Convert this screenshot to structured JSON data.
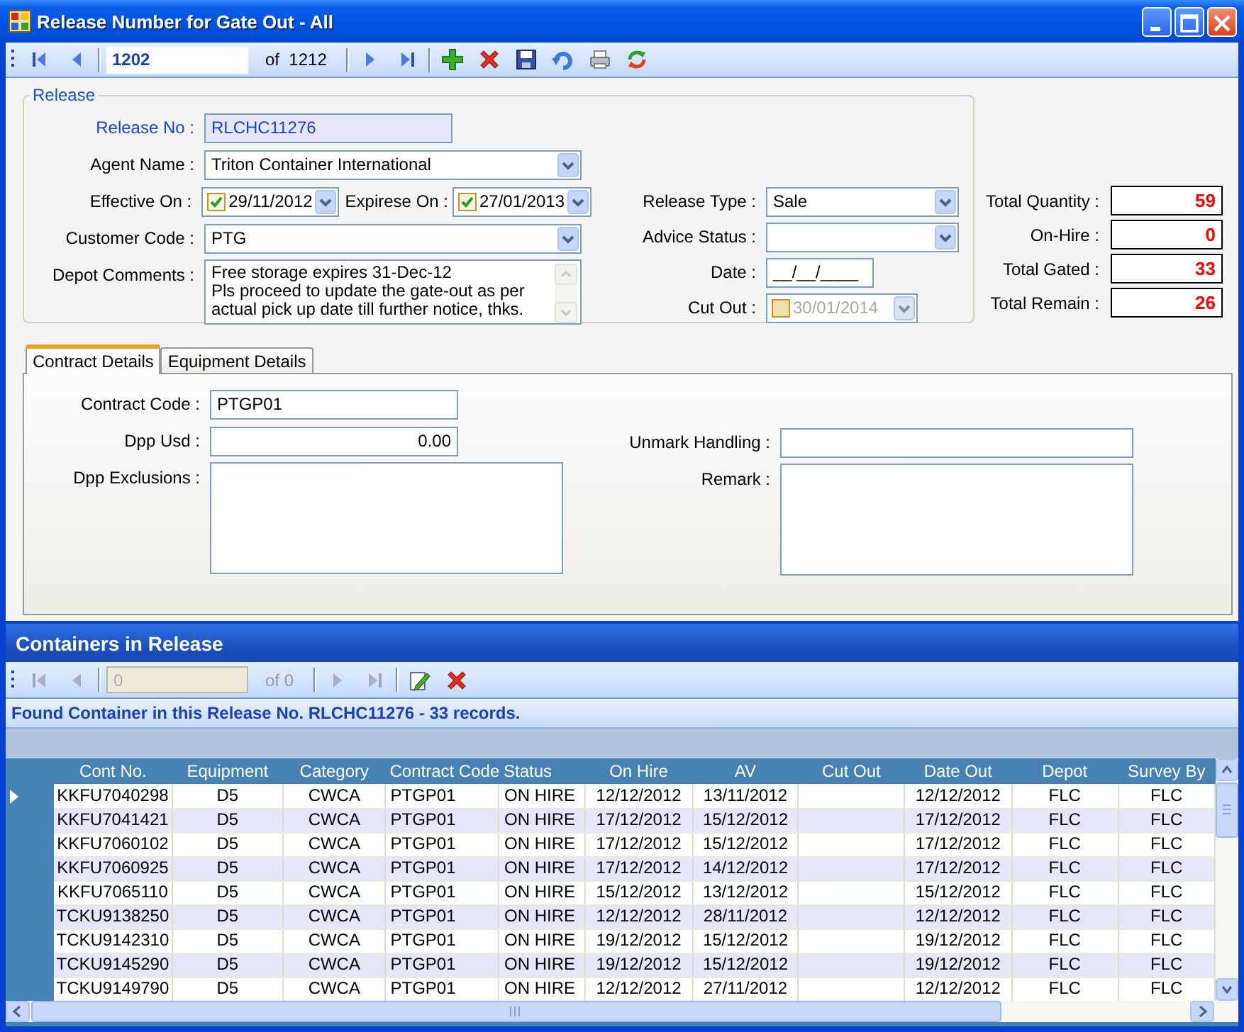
{
  "window": {
    "title": "Release Number for Gate Out - All"
  },
  "navigator": {
    "record": "1202",
    "total": "of  1212"
  },
  "release": {
    "legend": "Release",
    "left_fields": [
      {
        "kind": "readonly",
        "label": "Release No :",
        "value": "RLCHC11276"
      },
      {
        "kind": "combo",
        "label": "Agent Name :",
        "value": "Triton Container International"
      },
      {
        "kind": "date_pair",
        "label": "Effective On :",
        "dates": [
          {
            "value": "29/11/2012",
            "checked": true
          },
          {
            "label": "Expirese On :",
            "value": "27/01/2013",
            "checked": true
          }
        ]
      },
      {
        "kind": "combo",
        "label": "Customer Code :",
        "value": "PTG"
      },
      {
        "kind": "memo",
        "label": "Depot Comments :",
        "value": "Free storage expires 31-Dec-12\nPls proceed to update the gate-out as per actual pick up date till further notice, thks."
      }
    ],
    "right_fields": [
      {
        "kind": "combo",
        "label": "Release Type :",
        "value": "Sale"
      },
      {
        "kind": "combo",
        "label": "Advice Status :"
      },
      {
        "kind": "masked",
        "label": "Date :",
        "value": "__/__/____"
      },
      {
        "kind": "date",
        "label": "Cut Out :",
        "value": "30/01/2014",
        "checked": false,
        "disabled": true
      }
    ]
  },
  "totals": [
    {
      "label": "Total Quantity :",
      "value": "59"
    },
    {
      "label": "On-Hire :",
      "value": "0"
    },
    {
      "label": "Total Gated :",
      "value": "33"
    },
    {
      "label": "Total Remain :",
      "value": "26"
    }
  ],
  "tabs": [
    {
      "label": "Contract Details",
      "selected": true
    },
    {
      "label": "Equipment Details",
      "selected": false
    }
  ],
  "contract": {
    "left_fields": [
      {
        "kind": "text",
        "label": "Contract Code :",
        "value": "PTGP01"
      },
      {
        "kind": "number",
        "label": "Dpp Usd :",
        "value": "0.00"
      },
      {
        "kind": "memo",
        "label": "Dpp Exclusions :"
      }
    ],
    "right_fields": [
      {
        "kind": "text",
        "label": "Unmark Handling :"
      },
      {
        "kind": "memo",
        "label": "Remark :"
      }
    ]
  },
  "containers": {
    "title": "Containers in Release",
    "navigator": {
      "record": "0",
      "total": "of 0"
    },
    "message": "Found Container in this Release No. RLCHC11276 - 33 records.",
    "columns": [
      "Cont No.",
      "Equipment",
      "Category",
      "Contract Code",
      "Status",
      "On Hire",
      "AV",
      "Cut Out",
      "Date Out",
      "Depot",
      "Survey By"
    ],
    "rows": [
      {
        "current": true,
        "cells": [
          "KKFU7040298",
          "D5",
          "CWCA",
          "PTGP01",
          "ON HIRE",
          "12/12/2012",
          "13/11/2012",
          null,
          "12/12/2012",
          "FLC",
          "FLC"
        ]
      },
      {
        "current": false,
        "cells": [
          "KKFU7041421",
          "D5",
          "CWCA",
          "PTGP01",
          "ON HIRE",
          "17/12/2012",
          "15/12/2012",
          null,
          "17/12/2012",
          "FLC",
          "FLC"
        ]
      },
      {
        "current": false,
        "cells": [
          "KKFU7060102",
          "D5",
          "CWCA",
          "PTGP01",
          "ON HIRE",
          "17/12/2012",
          "15/12/2012",
          null,
          "17/12/2012",
          "FLC",
          "FLC"
        ]
      },
      {
        "current": false,
        "cells": [
          "KKFU7060925",
          "D5",
          "CWCA",
          "PTGP01",
          "ON HIRE",
          "17/12/2012",
          "14/12/2012",
          null,
          "17/12/2012",
          "FLC",
          "FLC"
        ]
      },
      {
        "current": false,
        "cells": [
          "KKFU7065110",
          "D5",
          "CWCA",
          "PTGP01",
          "ON HIRE",
          "15/12/2012",
          "13/12/2012",
          null,
          "15/12/2012",
          "FLC",
          "FLC"
        ]
      },
      {
        "current": false,
        "cells": [
          "TCKU9138250",
          "D5",
          "CWCA",
          "PTGP01",
          "ON HIRE",
          "12/12/2012",
          "28/11/2012",
          null,
          "12/12/2012",
          "FLC",
          "FLC"
        ]
      },
      {
        "current": false,
        "cells": [
          "TCKU9142310",
          "D5",
          "CWCA",
          "PTGP01",
          "ON HIRE",
          "19/12/2012",
          "15/12/2012",
          null,
          "19/12/2012",
          "FLC",
          "FLC"
        ]
      },
      {
        "current": false,
        "cells": [
          "TCKU9145290",
          "D5",
          "CWCA",
          "PTGP01",
          "ON HIRE",
          "19/12/2012",
          "15/12/2012",
          null,
          "19/12/2012",
          "FLC",
          "FLC"
        ]
      },
      {
        "current": false,
        "cells": [
          "TCKU9149790",
          "D5",
          "CWCA",
          "PTGP01",
          "ON HIRE",
          "12/12/2012",
          "27/11/2012",
          null,
          "12/12/2012",
          "FLC",
          "FLC"
        ]
      }
    ]
  }
}
